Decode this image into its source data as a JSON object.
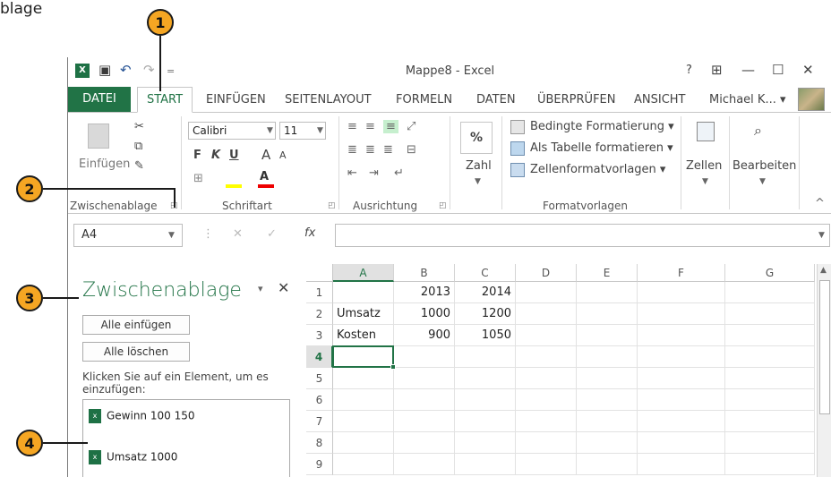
{
  "page_label": "blage",
  "callouts": [
    "1",
    "2",
    "3",
    "4"
  ],
  "titlebar": {
    "title": "Mappe8 - Excel",
    "qa_undo": "↶",
    "qa_redo": "↷",
    "qa_more": "=",
    "help": "?",
    "ribbon_opts": "⊞",
    "minimize": "—",
    "maximize": "☐",
    "close": "✕"
  },
  "tabs": {
    "file": "DATEI",
    "start": "START",
    "items": [
      "EINFÜGEN",
      "SEITENLAYOUT",
      "FORMELN",
      "DATEN",
      "ÜBERPRÜFEN",
      "ANSICHT"
    ],
    "user": "Michael K...  ▾"
  },
  "ribbon": {
    "paste": "Einfügen",
    "clipboard_group": "Zwischenablage",
    "font_group": "Schriftart",
    "align_group": "Ausrichtung",
    "styles_group": "Formatvorlagen",
    "font_name": "Calibri",
    "font_size": "11",
    "bold": "F",
    "italic": "K",
    "underline": "U",
    "grow": "A",
    "shrink": "A",
    "number_sym": "%",
    "number_label": "Zahl",
    "cond_format": "Bedingte Formatierung ▾",
    "as_table": "Als Tabelle formatieren ▾",
    "cell_styles": "Zellenformatvorlagen ▾",
    "cells": "Zellen",
    "edit": "Bearbeiten",
    "collapse": "^"
  },
  "formula_bar": {
    "name_box": "A4",
    "fx": "fx",
    "cancel": "✕",
    "enter": "✓",
    "value": ""
  },
  "pane": {
    "title": "Zwischenablage",
    "paste_all": "Alle einfügen",
    "clear_all": "Alle löschen",
    "hint": "Klicken Sie auf ein Element, um es einzufügen:",
    "items": [
      "Gewinn 100 150",
      "Umsatz 1000"
    ],
    "close": "✕",
    "menu": "▾"
  },
  "sheet": {
    "columns": [
      "A",
      "B",
      "C",
      "D",
      "E",
      "F",
      "G"
    ],
    "rows": [
      "1",
      "2",
      "3",
      "4",
      "5",
      "6",
      "7",
      "8",
      "9"
    ],
    "cells": [
      [
        "",
        "2013",
        "2014",
        "",
        "",
        "",
        ""
      ],
      [
        "Umsatz",
        "1000",
        "1200",
        "",
        "",
        "",
        ""
      ],
      [
        "Kosten",
        "900",
        "1050",
        "",
        "",
        "",
        ""
      ],
      [
        "",
        "",
        "",
        "",
        "",
        "",
        ""
      ],
      [
        "",
        "",
        "",
        "",
        "",
        "",
        ""
      ],
      [
        "",
        "",
        "",
        "",
        "",
        "",
        ""
      ],
      [
        "",
        "",
        "",
        "",
        "",
        "",
        ""
      ],
      [
        "",
        "",
        "",
        "",
        "",
        "",
        ""
      ],
      [
        "",
        "",
        "",
        "",
        "",
        "",
        ""
      ]
    ],
    "active_cell": "A4"
  },
  "colors": {
    "accent": "#217346",
    "callout": "#f5a623"
  }
}
